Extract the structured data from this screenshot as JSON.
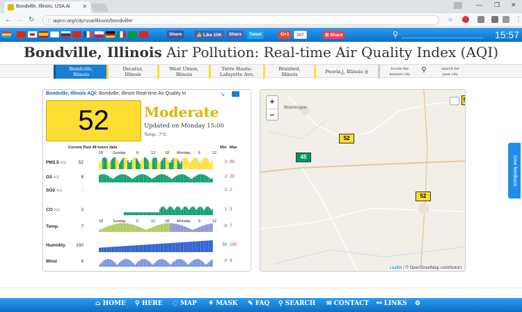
{
  "browser": {
    "tab_title": "Bondville, Illinois, USA Ai",
    "url": "aqicn.org/city/usa/illinois/bondville/"
  },
  "topbar": {
    "share_fb": "Share",
    "like": "Like 10K",
    "share2": "Share",
    "tweet": "Tweet",
    "gplus": "G+1",
    "gplus_count": "207",
    "share3": "Share",
    "time": "15:57"
  },
  "page": {
    "title_city": "Bondville, Illinois",
    "title_rest": " Air Pollution: Real-time Air Quality Index (AQI)"
  },
  "cities": [
    {
      "label": "Bondville,\nIllinois"
    },
    {
      "label": "Decatur,\nIllinois"
    },
    {
      "label": "West Union,\nIllinois"
    },
    {
      "label": "Terre Haute-\nLafayette Ave,"
    },
    {
      "label": "Braidwd,\nIllinois"
    },
    {
      "label": "Peoria,j, Illinois"
    },
    {
      "label": "locate the\nnearest city"
    },
    {
      "label": "search for\nyour city"
    }
  ],
  "aqi_panel": {
    "header_link": "Bondville, Illinois AQI:",
    "header_desc": " Bondville, Illinois Real-time Air Quality In",
    "aqi_value": "52",
    "level": "Moderate",
    "updated": "Updated on Monday 15:00",
    "temp": "Temp.: 7°C",
    "past_label": "Current Past 48 hours data",
    "min_label": "Min",
    "max_label": "Max",
    "ticks_top": [
      "18",
      "Sunday",
      "6",
      "12",
      "18",
      "Monday",
      "6",
      "12"
    ],
    "rows": [
      {
        "name": "PM2.5",
        "unit": "AQI",
        "current": "52",
        "min": "3",
        "max": "98"
      },
      {
        "name": "O3",
        "unit": "AQI",
        "current": "8",
        "min": "2",
        "max": "26"
      },
      {
        "name": "SO2",
        "unit": "AQI",
        "current": "-",
        "min": "2",
        "max": "2"
      },
      {
        "name": "CO",
        "unit": "AQI",
        "current": "2",
        "min": "1",
        "max": "3"
      },
      {
        "name": "Temp.",
        "unit": "",
        "current": "7",
        "min": "-8",
        "max": "7"
      },
      {
        "name": "Humidity",
        "unit": "",
        "current": "100",
        "min": "50",
        "max": "100"
      },
      {
        "name": "Wind",
        "unit": "",
        "current": "6",
        "min": "0",
        "max": "9"
      }
    ]
  },
  "map": {
    "zoom_in": "+",
    "zoom_out": "−",
    "place": "Bloomington",
    "markers": [
      "52",
      "45",
      "52",
      "5"
    ],
    "attribution_leaflet": "Leaflet",
    "attribution_rest": " | © OpenStreetMap contributors"
  },
  "feedback": "Give feedback",
  "bottom_nav": [
    "HOME",
    "HERE",
    "MAP",
    "MASK",
    "FAQ",
    "SEARCH",
    "CONTACT",
    "LINKS"
  ]
}
